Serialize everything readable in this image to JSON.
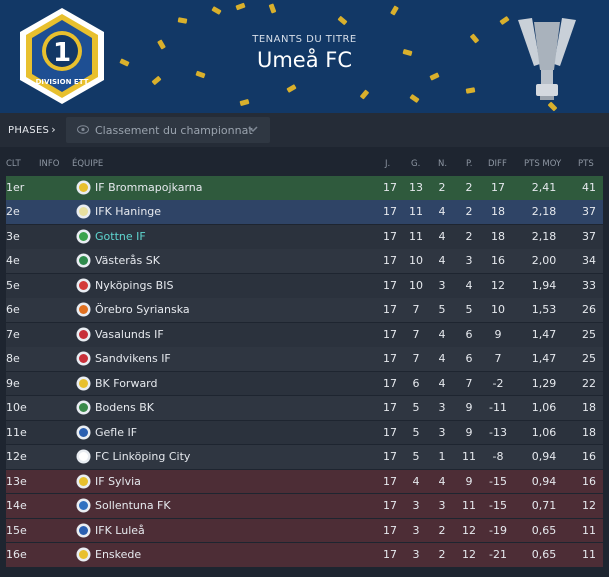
{
  "header": {
    "subtitle": "TENANTS DU TITRE",
    "title": "Umeå FC",
    "badge_number": "1",
    "badge_text": "DIVISION ETT"
  },
  "phases": {
    "label": "PHASES",
    "dropdown_label": "Classement du championnat"
  },
  "columns": {
    "clt": "CLT",
    "info": "INFO",
    "team": "ÉQUIPE",
    "played": "J.",
    "won": "G.",
    "drawn": "N.",
    "lost": "P.",
    "diff": "DIFF",
    "pts_avg": "PTS MOY",
    "pts": "PTS"
  },
  "colors": {
    "header_bg": "#123866",
    "champion_row": "#2f5a3d",
    "promotion_row": "#2f4466",
    "relegation_row": "#4d2d36",
    "highlight_team": "#5fd6d0",
    "confetti": "#d9b02c"
  },
  "rows": [
    {
      "pos": "1er",
      "team": "IF Brommapojkarna",
      "j": "17",
      "g": "13",
      "n": "2",
      "p": "2",
      "diff": "17",
      "moy": "2,41",
      "pts": "41",
      "zone": "champ",
      "crest": "#e8c02e"
    },
    {
      "pos": "2e",
      "team": "IFK Haninge",
      "j": "17",
      "g": "11",
      "n": "4",
      "p": "2",
      "diff": "18",
      "moy": "2,18",
      "pts": "37",
      "zone": "promo",
      "crest": "#e8e0a0"
    },
    {
      "pos": "3e",
      "team": "Gottne IF",
      "j": "17",
      "g": "11",
      "n": "4",
      "p": "2",
      "diff": "18",
      "moy": "2,18",
      "pts": "37",
      "zone": "",
      "crest": "#3ba34c"
    },
    {
      "pos": "4e",
      "team": "Västerås SK",
      "j": "17",
      "g": "10",
      "n": "4",
      "p": "3",
      "diff": "16",
      "moy": "2,00",
      "pts": "34",
      "zone": "alt",
      "crest": "#2e8a4c"
    },
    {
      "pos": "5e",
      "team": "Nyköpings BIS",
      "j": "17",
      "g": "10",
      "n": "3",
      "p": "4",
      "diff": "12",
      "moy": "1,94",
      "pts": "33",
      "zone": "",
      "crest": "#d43a3a"
    },
    {
      "pos": "6e",
      "team": "Örebro Syrianska",
      "j": "17",
      "g": "7",
      "n": "5",
      "p": "5",
      "diff": "10",
      "moy": "1,53",
      "pts": "26",
      "zone": "alt",
      "crest": "#e07020"
    },
    {
      "pos": "7e",
      "team": "Vasalunds IF",
      "j": "17",
      "g": "7",
      "n": "4",
      "p": "6",
      "diff": "9",
      "moy": "1,47",
      "pts": "25",
      "zone": "",
      "crest": "#c8303a"
    },
    {
      "pos": "8e",
      "team": "Sandvikens IF",
      "j": "17",
      "g": "7",
      "n": "4",
      "p": "6",
      "diff": "7",
      "moy": "1,47",
      "pts": "25",
      "zone": "alt",
      "crest": "#c8303a"
    },
    {
      "pos": "9e",
      "team": "BK Forward",
      "j": "17",
      "g": "6",
      "n": "4",
      "p": "7",
      "diff": "-2",
      "moy": "1,29",
      "pts": "22",
      "zone": "",
      "crest": "#e8c02e"
    },
    {
      "pos": "10e",
      "team": "Bodens BK",
      "j": "17",
      "g": "5",
      "n": "3",
      "p": "9",
      "diff": "-11",
      "moy": "1,06",
      "pts": "18",
      "zone": "alt",
      "crest": "#3a8a4a"
    },
    {
      "pos": "11e",
      "team": "Gefle IF",
      "j": "17",
      "g": "5",
      "n": "3",
      "p": "9",
      "diff": "-13",
      "moy": "1,06",
      "pts": "18",
      "zone": "",
      "crest": "#2a5fb0"
    },
    {
      "pos": "12e",
      "team": "FC Linköping City",
      "j": "17",
      "g": "5",
      "n": "1",
      "p": "11",
      "diff": "-8",
      "moy": "0,94",
      "pts": "16",
      "zone": "alt",
      "crest": "#ffffff"
    },
    {
      "pos": "13e",
      "team": "IF Sylvia",
      "j": "17",
      "g": "4",
      "n": "4",
      "p": "9",
      "diff": "-15",
      "moy": "0,94",
      "pts": "16",
      "zone": "releg",
      "crest": "#e8c02e"
    },
    {
      "pos": "14e",
      "team": "Sollentuna FK",
      "j": "17",
      "g": "3",
      "n": "3",
      "p": "11",
      "diff": "-15",
      "moy": "0,71",
      "pts": "12",
      "zone": "releg",
      "crest": "#3070c0"
    },
    {
      "pos": "15e",
      "team": "IFK Luleå",
      "j": "17",
      "g": "3",
      "n": "2",
      "p": "12",
      "diff": "-19",
      "moy": "0,65",
      "pts": "11",
      "zone": "releg",
      "crest": "#2a5fb0"
    },
    {
      "pos": "16e",
      "team": "Enskede",
      "j": "17",
      "g": "3",
      "n": "2",
      "p": "12",
      "diff": "-21",
      "moy": "0,65",
      "pts": "11",
      "zone": "releg",
      "crest": "#e8c02e"
    }
  ]
}
